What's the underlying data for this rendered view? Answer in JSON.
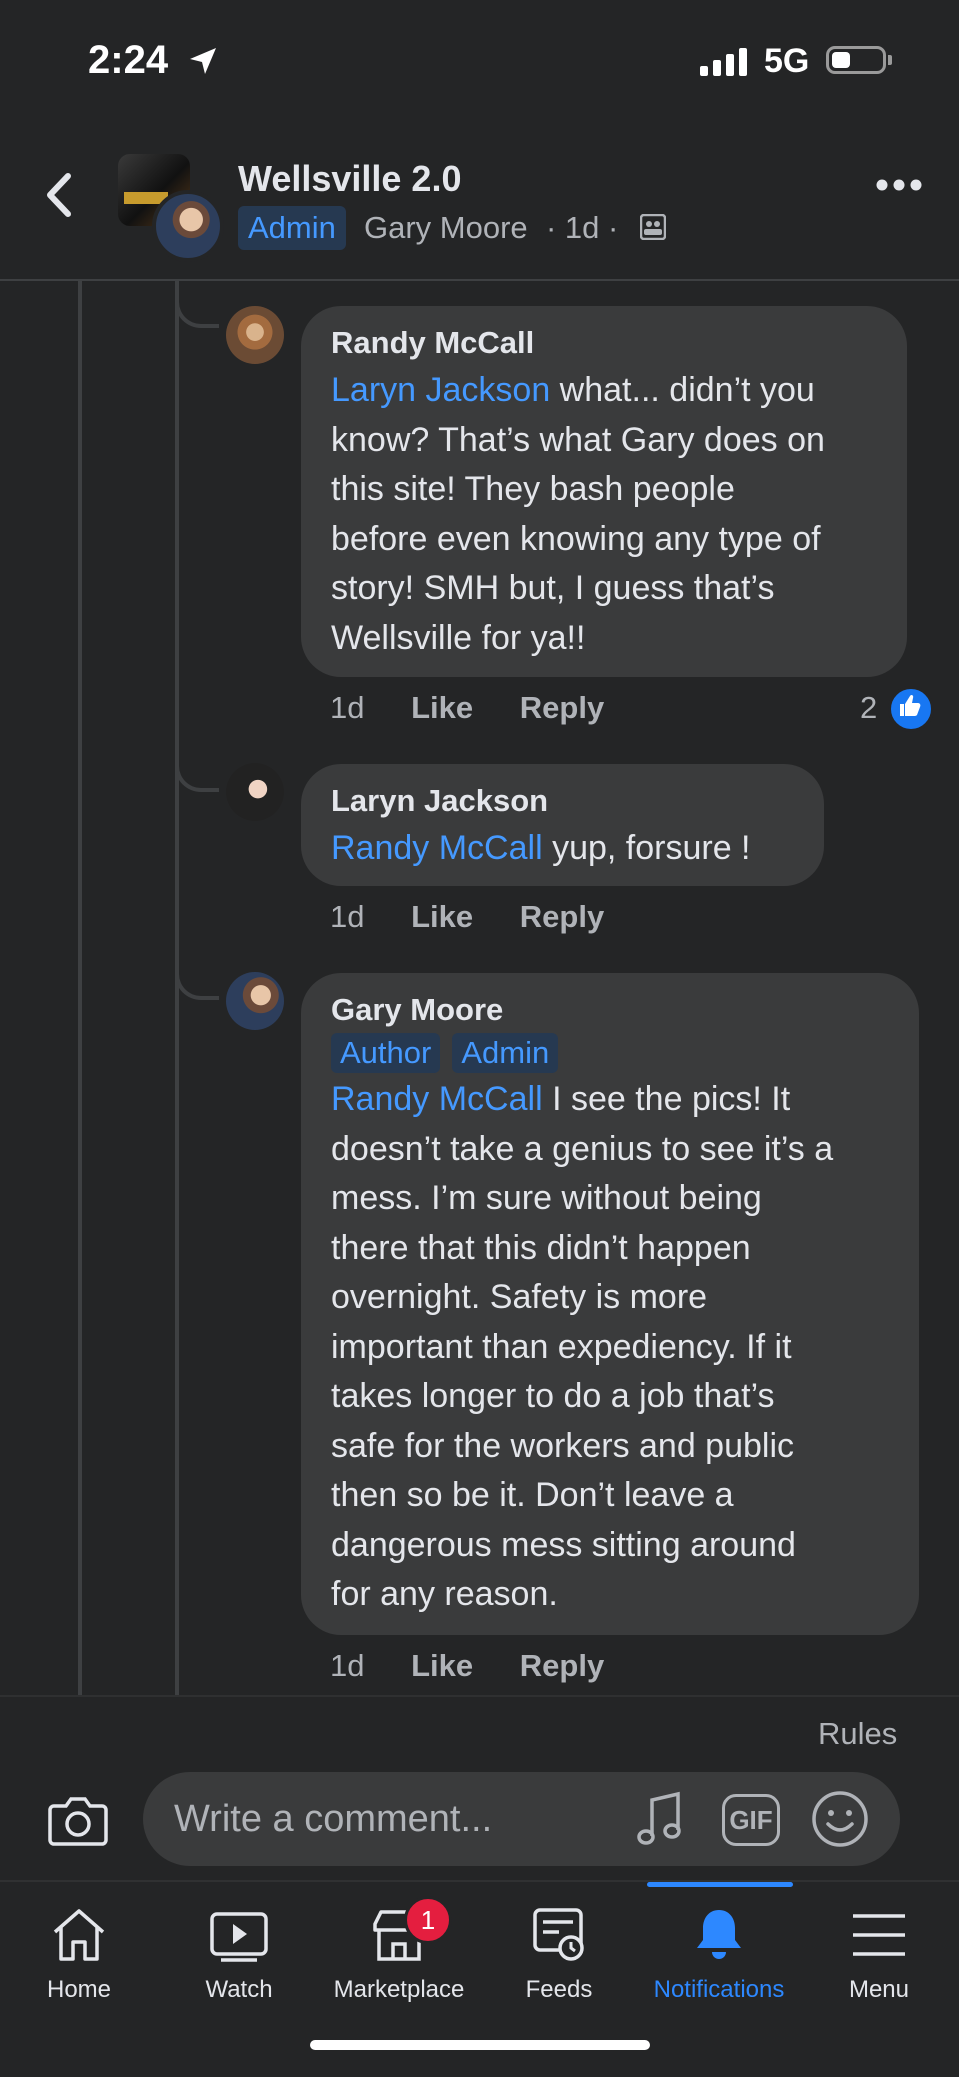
{
  "status_bar": {
    "time": "2:24",
    "carrier": "5G"
  },
  "header": {
    "group_name": "Wellsville 2.0",
    "admin_badge": "Admin",
    "author": "Gary Moore",
    "time": "· 1d ·"
  },
  "comments": [
    {
      "author": "Randy McCall",
      "mention": "Laryn Jackson",
      "lines": [
        " what... didn’t you",
        "know? That’s what Gary does on",
        "this site! They bash people",
        "before even knowing any type of",
        "story! SMH but, I guess that’s",
        "Wellsville for ya!!"
      ],
      "time": "1d",
      "like_label": "Like",
      "reply_label": "Reply",
      "reaction_count": "2"
    },
    {
      "author": "Laryn Jackson",
      "mention": "Randy McCall",
      "lines": [
        " yup, forsure !"
      ],
      "time": "1d",
      "like_label": "Like",
      "reply_label": "Reply"
    },
    {
      "author": "Gary Moore",
      "badges": [
        "Author",
        "Admin"
      ],
      "mention": "Randy McCall",
      "lines": [
        " I see the pics! It",
        "doesn’t take a genius to see it’s a",
        "mess. I’m sure without being",
        "there that this didn’t happen",
        "overnight. Safety is more",
        "important than expediency. If it",
        "takes longer to do a job that’s",
        "safe for the workers and public",
        "then so be it. Don’t leave a",
        "dangerous mess sitting around",
        "for any reason."
      ],
      "time": "1d",
      "like_label": "Like",
      "reply_label": "Reply"
    }
  ],
  "composer": {
    "rules_link": "Rules",
    "placeholder": "Write a comment...",
    "gif_label": "GIF"
  },
  "bottom_nav": {
    "items": [
      {
        "label": "Home",
        "icon": "home-icon"
      },
      {
        "label": "Watch",
        "icon": "watch-icon"
      },
      {
        "label": "Marketplace",
        "icon": "marketplace-icon",
        "badge": "1"
      },
      {
        "label": "Feeds",
        "icon": "feeds-icon"
      },
      {
        "label": "Notifications",
        "icon": "bell-icon",
        "active": true
      },
      {
        "label": "Menu",
        "icon": "menu-icon"
      }
    ]
  },
  "colors": {
    "accent": "#2d88ff",
    "mention": "#4599ff",
    "bubble": "#3a3b3c",
    "background": "#242526",
    "notification_badge": "#e41e3f"
  }
}
